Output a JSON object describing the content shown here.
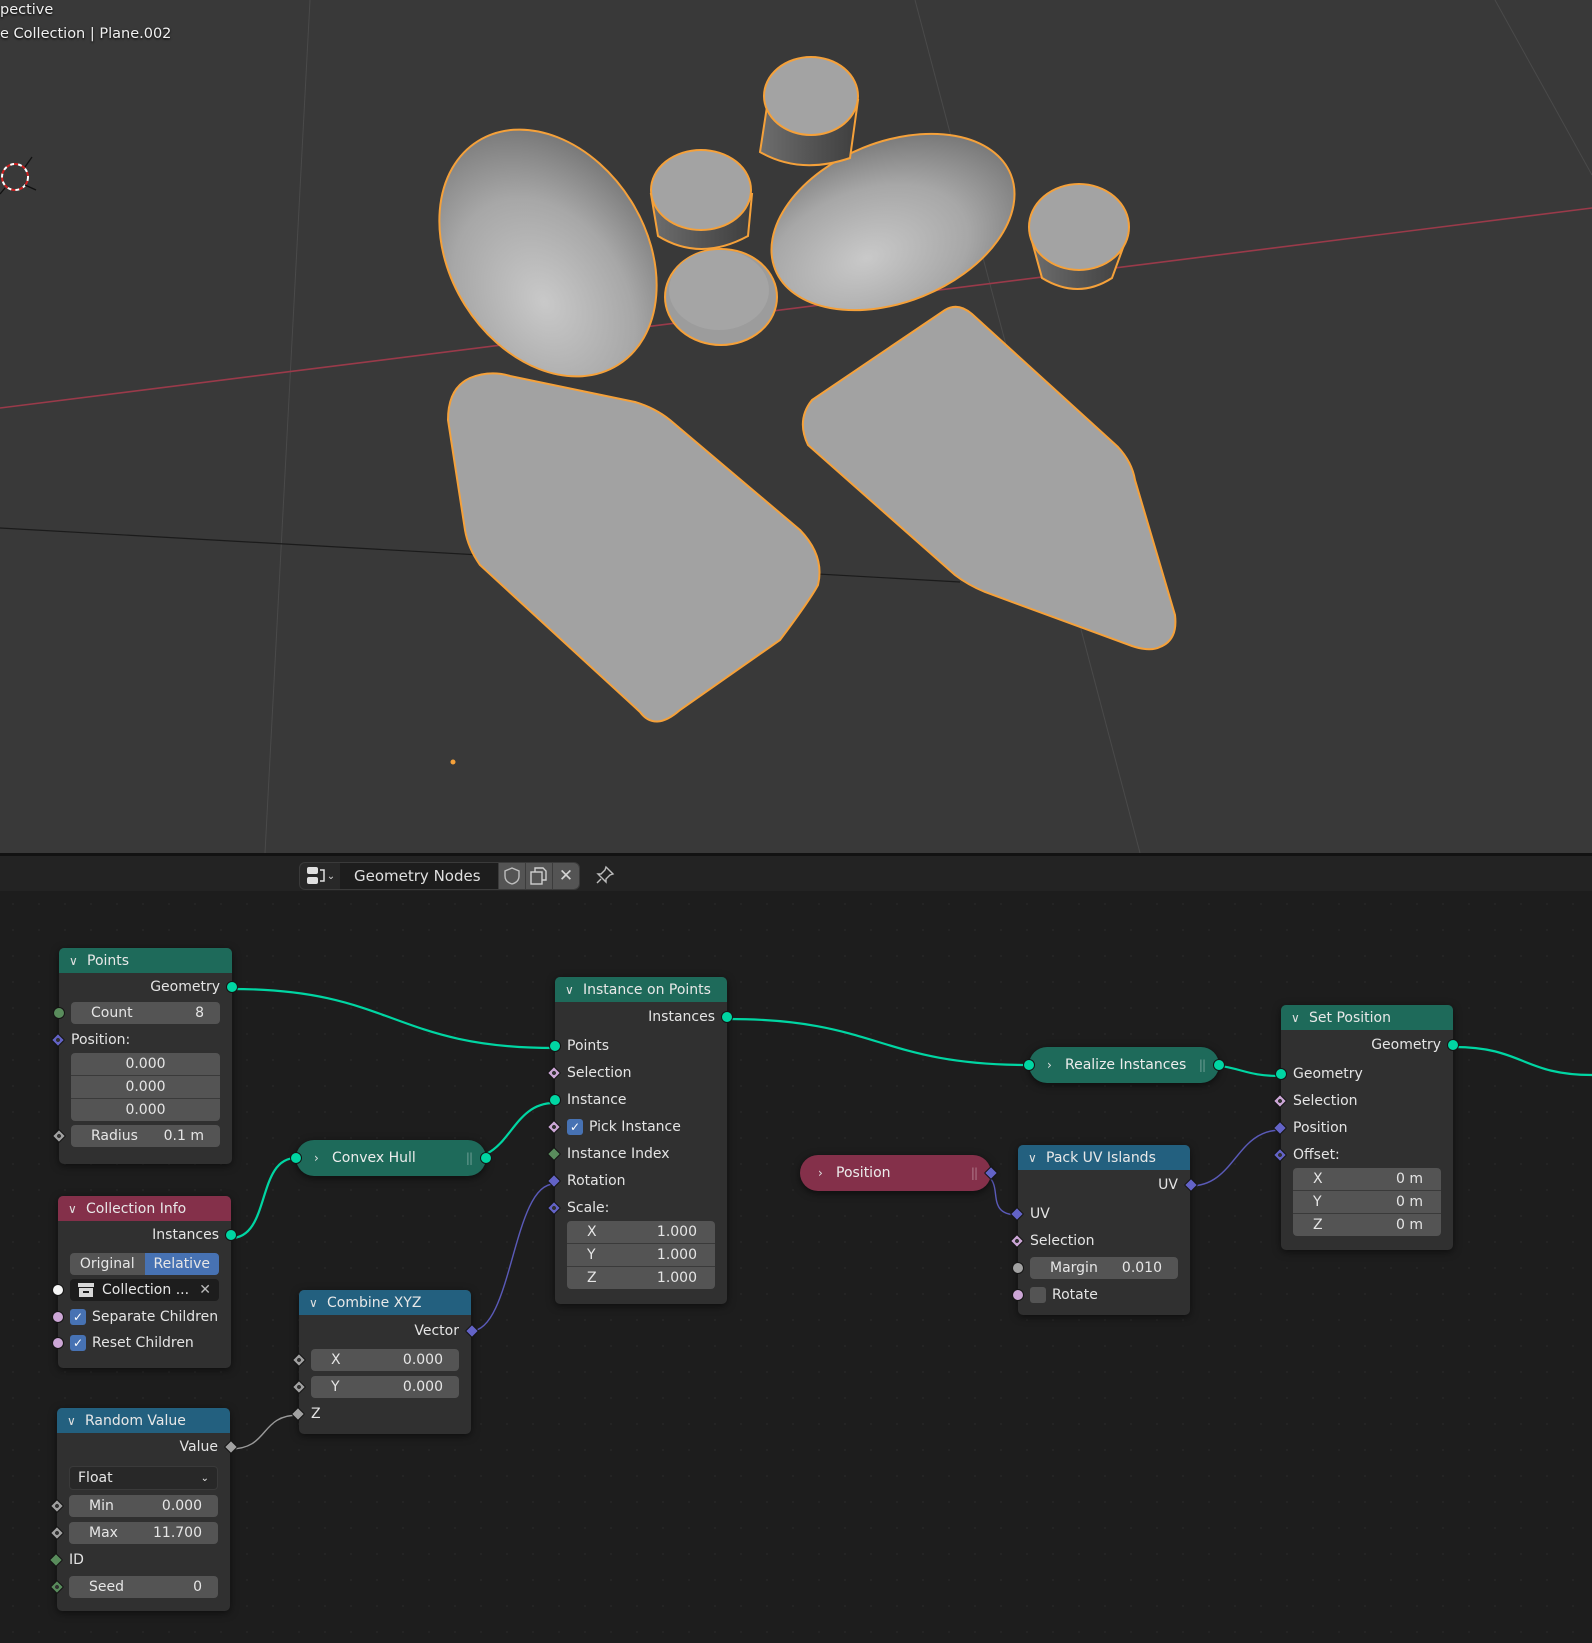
{
  "viewport": {
    "view_label": "pective",
    "object_label": "e Collection | Plane.002",
    "colors": {
      "background": "#393939",
      "selection_outline": "#f5a13a",
      "x_axis": "#9a3a4a",
      "mesh": "#a5a5a5"
    }
  },
  "header": {
    "editor_type_icon": "node-editor-icon",
    "tree_name": "Geometry Nodes",
    "fake_user_icon": "shield-icon",
    "duplicate_icon": "duplicate-icon",
    "unlink_icon": "close-icon",
    "pin_icon": "pin-icon"
  },
  "colors": {
    "geometry_header": "#1e6a5a",
    "input_header": "#84304a",
    "vector_header": "#23607f",
    "geometry_socket": "#00d6a3",
    "vector_socket": "#6363c7",
    "bool_socket": "#cca6d6",
    "int_socket": "#598c5c",
    "float_socket": "#a1a1a1",
    "collection_socket": "#f5f5f5",
    "checkbox": "#4772b3"
  },
  "nodes": {
    "points": {
      "title": "Points",
      "output": "Geometry",
      "count_label": "Count",
      "count_value": "8",
      "position_label": "Position:",
      "position": [
        "0.000",
        "0.000",
        "0.000"
      ],
      "radius_label": "Radius",
      "radius_value": "0.1 m"
    },
    "collection_info": {
      "title": "Collection Info",
      "output": "Instances",
      "transform_options": [
        "Original",
        "Relative"
      ],
      "transform_selected": "Relative",
      "collection_value": "Collection ...",
      "separate_children": "Separate Children",
      "separate_children_checked": true,
      "reset_children": "Reset Children",
      "reset_children_checked": true
    },
    "random_value": {
      "title": "Random Value",
      "output": "Value",
      "data_type": "Float",
      "min_label": "Min",
      "min_value": "0.000",
      "max_label": "Max",
      "max_value": "11.700",
      "id_label": "ID",
      "seed_label": "Seed",
      "seed_value": "0"
    },
    "convex_hull": {
      "title": "Convex Hull"
    },
    "combine_xyz": {
      "title": "Combine XYZ",
      "output": "Vector",
      "x_label": "X",
      "x_value": "0.000",
      "y_label": "Y",
      "y_value": "0.000",
      "z_label": "Z"
    },
    "instance_on_points": {
      "title": "Instance on Points",
      "output": "Instances",
      "points": "Points",
      "selection": "Selection",
      "instance": "Instance",
      "pick_instance": "Pick Instance",
      "pick_instance_checked": true,
      "instance_index": "Instance Index",
      "rotation": "Rotation",
      "scale_label": "Scale:",
      "scale": [
        {
          "axis": "X",
          "value": "1.000"
        },
        {
          "axis": "Y",
          "value": "1.000"
        },
        {
          "axis": "Z",
          "value": "1.000"
        }
      ]
    },
    "realize_instances": {
      "title": "Realize Instances"
    },
    "position": {
      "title": "Position"
    },
    "pack_uv_islands": {
      "title": "Pack UV Islands",
      "output": "UV",
      "uv": "UV",
      "selection": "Selection",
      "margin_label": "Margin",
      "margin_value": "0.010",
      "rotate": "Rotate",
      "rotate_checked": false
    },
    "set_position": {
      "title": "Set Position",
      "output": "Geometry",
      "geometry": "Geometry",
      "selection": "Selection",
      "position": "Position",
      "offset_label": "Offset:",
      "offset": [
        {
          "axis": "X",
          "value": "0 m"
        },
        {
          "axis": "Y",
          "value": "0 m"
        },
        {
          "axis": "Z",
          "value": "0 m"
        }
      ]
    }
  }
}
